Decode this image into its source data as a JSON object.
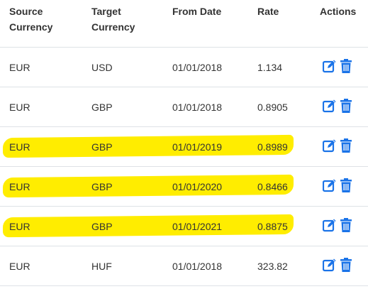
{
  "columns": {
    "source": "Source\nCurrency",
    "target": "Target\nCurrency",
    "from_date": "From Date",
    "rate": "Rate",
    "actions": "Actions"
  },
  "rows": [
    {
      "source": "EUR",
      "target": "USD",
      "from_date": "01/01/2018",
      "rate": "1.134",
      "highlighted": false
    },
    {
      "source": "EUR",
      "target": "GBP",
      "from_date": "01/01/2018",
      "rate": "0.8905",
      "highlighted": false
    },
    {
      "source": "EUR",
      "target": "GBP",
      "from_date": "01/01/2019",
      "rate": "0.8989",
      "highlighted": true
    },
    {
      "source": "EUR",
      "target": "GBP",
      "from_date": "01/01/2020",
      "rate": "0.8466",
      "highlighted": true
    },
    {
      "source": "EUR",
      "target": "GBP",
      "from_date": "01/01/2021",
      "rate": "0.8875",
      "highlighted": true
    },
    {
      "source": "EUR",
      "target": "HUF",
      "from_date": "01/01/2018",
      "rate": "323.82",
      "highlighted": false
    }
  ],
  "icons": {
    "edit": "edit-icon",
    "delete": "trash-icon"
  },
  "colors": {
    "icon": "#1a73e8",
    "highlight": "#ffed00",
    "border": "#dee2e6"
  }
}
